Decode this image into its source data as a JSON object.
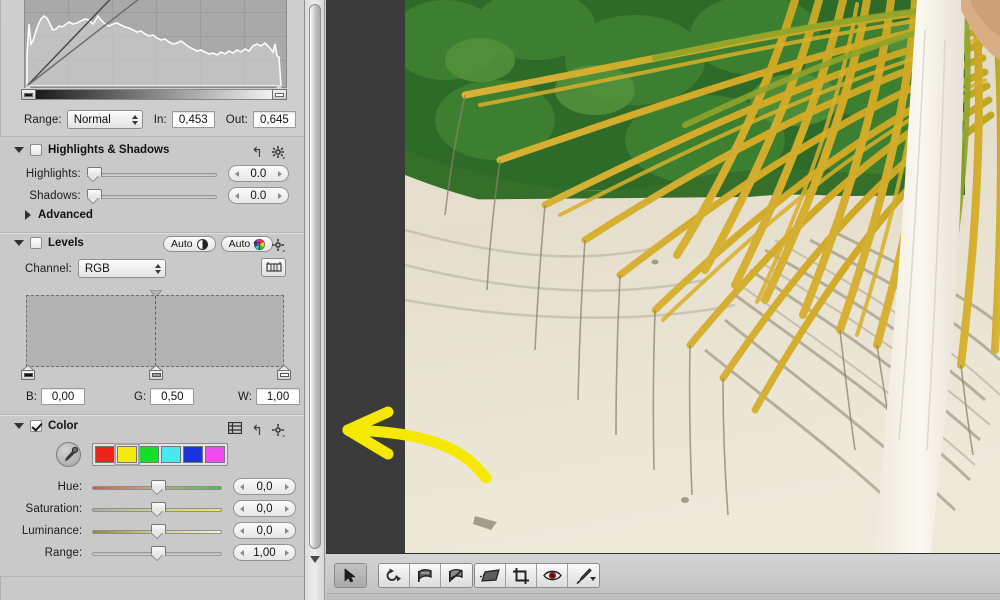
{
  "app": {
    "name": "Aperture Adjustments Inspector",
    "accent_yellow": "#f5e900",
    "panel_bg": "#c9c9c9",
    "viewer_bg": "#3b3b3b"
  },
  "curves": {
    "range_label": "Range:",
    "range_value": "Normal",
    "in_label": "In:",
    "in_value": "0,453",
    "out_label": "Out:",
    "out_value": "0,645"
  },
  "highlights_shadows": {
    "title": "Highlights & Shadows",
    "enabled": false,
    "expanded": true,
    "reset_icon": "reset-arrow-icon",
    "gear_icon": "gear-icon",
    "sliders": [
      {
        "label": "Highlights:",
        "value": "0.0",
        "knob_pct": 2
      },
      {
        "label": "Shadows:",
        "value": "0.0",
        "knob_pct": 2
      }
    ],
    "advanced_label": "Advanced",
    "advanced_expanded": false
  },
  "levels": {
    "title": "Levels",
    "enabled": false,
    "expanded": true,
    "auto_luminance_label": "Auto",
    "auto_color_label": "Auto",
    "channel_label": "Channel:",
    "channel_value": "RGB",
    "quarter_tone_icon": "quarter-tone-levels-icon",
    "reset_icon": "reset-arrow-icon",
    "gear_icon": "gear-icon",
    "black_label": "B:",
    "black_value": "0,00",
    "gray_label": "G:",
    "gray_value": "0,50",
    "white_label": "W:",
    "white_value": "1,00"
  },
  "color": {
    "title": "Color",
    "enabled": true,
    "expanded": true,
    "expand_icon": "expanded-view-icon",
    "reset_icon": "reset-arrow-icon",
    "gear_icon": "gear-icon",
    "eyedropper_icon": "eyedropper-icon",
    "swatches": [
      {
        "name": "red",
        "hex": "#ee2418",
        "selected": false
      },
      {
        "name": "yellow",
        "hex": "#f5ea14",
        "selected": true
      },
      {
        "name": "green",
        "hex": "#19dd2b",
        "selected": false
      },
      {
        "name": "cyan",
        "hex": "#4ae8ec",
        "selected": false
      },
      {
        "name": "blue",
        "hex": "#1c34dd",
        "selected": false
      },
      {
        "name": "magenta",
        "hex": "#ee4cec",
        "selected": false
      }
    ],
    "sliders": [
      {
        "label": "Hue:",
        "value": "0,0",
        "knob_pct": 50,
        "track": "hue"
      },
      {
        "label": "Saturation:",
        "value": "0,0",
        "knob_pct": 50,
        "track": "sat"
      },
      {
        "label": "Luminance:",
        "value": "0,0",
        "knob_pct": 50,
        "track": "lum"
      },
      {
        "label": "Range:",
        "value": "1,00",
        "knob_pct": 50,
        "track": "plain"
      }
    ]
  },
  "toolbar": {
    "groups": [
      {
        "buttons": [
          {
            "name": "selection-tool",
            "icon": "cursor-arrow-icon",
            "active": true
          }
        ]
      },
      {
        "buttons": [
          {
            "name": "rotate-counterclockwise-tool",
            "icon": "rotate-ccw-icon",
            "active": false
          },
          {
            "name": "flag-tool",
            "icon": "flag-icon",
            "active": false
          },
          {
            "name": "unflag-tool",
            "icon": "unflag-icon",
            "active": false
          }
        ]
      },
      {
        "buttons": [
          {
            "name": "straighten-tool",
            "icon": "straighten-icon",
            "active": false
          },
          {
            "name": "crop-tool",
            "icon": "crop-icon",
            "active": false
          },
          {
            "name": "red-eye-tool",
            "icon": "red-eye-icon",
            "active": false
          },
          {
            "name": "retouch-tool",
            "icon": "retouch-brush-icon",
            "active": false,
            "has_menu": true
          }
        ]
      }
    ]
  },
  "scrollbar": {
    "name": "inspector-scrollbar",
    "thumb_icon": "scroll-thumb",
    "arrow_icon": "scroll-down-arrow-icon"
  },
  "annotation": {
    "name": "yellow-arrow-annotation",
    "direction": "left",
    "color": "#f5e900"
  },
  "photo": {
    "name": "beach-palm-frond-photo",
    "description": "Beach scene with yellow-green palm fronds, white sand, green foliage and a white dress"
  }
}
